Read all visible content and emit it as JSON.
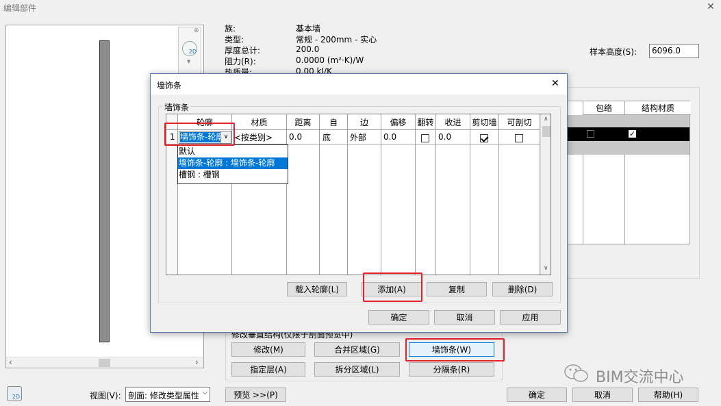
{
  "window": {
    "title": "编辑部件"
  },
  "props": {
    "labels": [
      "族:",
      "类型:",
      "厚度总计:",
      "阻力(R):",
      "热质量:"
    ],
    "values": [
      "基本墙",
      "常规 - 200mm - 实心",
      "200.0",
      "0.0000 (m²·K)/W",
      "0.00 kJ/K"
    ]
  },
  "sample_height": {
    "label": "样本高度(S):",
    "value": "6096.0"
  },
  "layers_header": {
    "wrap": "包络",
    "struct": "结构材质"
  },
  "modify_group": {
    "title": "修改垂直结构(仅限于剖面预览中)"
  },
  "buttons": {
    "modify": "修改(M)",
    "merge": "合并区域(G)",
    "sweeps": "墙饰条(W)",
    "assign": "指定层(A)",
    "split": "拆分区域(L)",
    "reveals": "分隔条(R)",
    "preview": "预览 >>(P)",
    "ok": "确定",
    "cancel": "取消",
    "help": "帮助(H)"
  },
  "view": {
    "label": "视图(V):",
    "value": "剖面: 修改类型属性"
  },
  "watermark": "BIM交流中心",
  "dialog": {
    "title": "墙饰条",
    "group": "墙饰条",
    "columns": [
      "轮廓",
      "材质",
      "距离",
      "自",
      "边",
      "偏移",
      "翻转",
      "收进",
      "剪切墙",
      "可剖切"
    ],
    "row": {
      "num": "1",
      "profile": "墙饰条-轮廓",
      "material": "<按类别>",
      "distance": "0.0",
      "from": "底",
      "side": "外部",
      "offset": "0.0",
      "flip": false,
      "setback": "0.0",
      "cut_wall": true,
      "cuttable": false
    },
    "dropdown_options": [
      "默认",
      "墙饰条-轮廓 : 墙饰条-轮廓",
      "槽钢 : 槽钢"
    ],
    "selected_option": 1,
    "buttons": {
      "load_profile": "载入轮廓(L)",
      "add": "添加(A)",
      "duplicate": "复制",
      "delete": "删除(D)",
      "ok": "确定",
      "cancel": "取消",
      "apply": "应用"
    }
  }
}
